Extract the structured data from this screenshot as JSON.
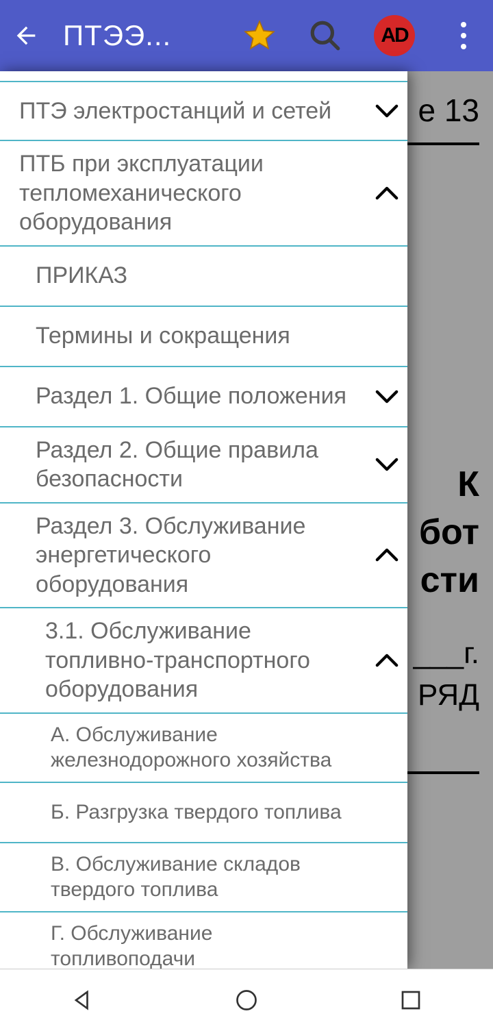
{
  "app_bar": {
    "title": "ПТЭЭ..."
  },
  "background": {
    "line1": "е 13",
    "heading1": "К",
    "heading2": "бот",
    "heading3": "сти",
    "line_date": "___г.",
    "line_ryad": "РЯД"
  },
  "drawer": {
    "items": [
      {
        "label": "ПТЭ электростанций и сетей",
        "stripes": [
          "teal"
        ],
        "chevron": "down",
        "indent": 1
      },
      {
        "label": "ПТБ при эксплуатации тепломеханического оборудования",
        "stripes": [
          "teal"
        ],
        "chevron": "up",
        "indent": 1
      },
      {
        "label": "ПРИКАЗ",
        "stripes": [
          "teal",
          "gold"
        ],
        "chevron": "",
        "indent": 2
      },
      {
        "label": "Термины и сокращения",
        "stripes": [
          "teal",
          "gold"
        ],
        "chevron": "",
        "indent": 2
      },
      {
        "label": "Раздел 1. Общие положения",
        "stripes": [
          "teal",
          "gold"
        ],
        "chevron": "down",
        "indent": 2
      },
      {
        "label": "Раздел 2. Общие правила безопасности",
        "stripes": [
          "teal",
          "gold"
        ],
        "chevron": "down",
        "indent": 2
      },
      {
        "label": "Раздел 3. Обслуживание энергетического оборудования",
        "stripes": [
          "teal",
          "gold"
        ],
        "chevron": "up",
        "indent": 2
      },
      {
        "label": "3.1. Обслуживание топливно-транспортного оборудования",
        "stripes": [
          "teal",
          "gold",
          "orange"
        ],
        "chevron": "up",
        "indent": 3
      },
      {
        "label": "А. Обслуживание железнодорожного хозяйства",
        "stripes": [
          "teal",
          "gold",
          "orange",
          "purple"
        ],
        "chevron": "",
        "indent": 4
      },
      {
        "label": "Б. Разгрузка твердого топлива",
        "stripes": [
          "teal",
          "gold",
          "orange",
          "purple"
        ],
        "chevron": "",
        "indent": 4
      },
      {
        "label": "В. Обслуживание складов твердого топлива",
        "stripes": [
          "teal",
          "gold",
          "orange",
          "purple"
        ],
        "chevron": "",
        "indent": 4
      },
      {
        "label": "Г. Обслуживание топливоподачи",
        "stripes": [
          "teal",
          "gold",
          "orange",
          "purple"
        ],
        "chevron": "",
        "indent": 4
      }
    ]
  }
}
